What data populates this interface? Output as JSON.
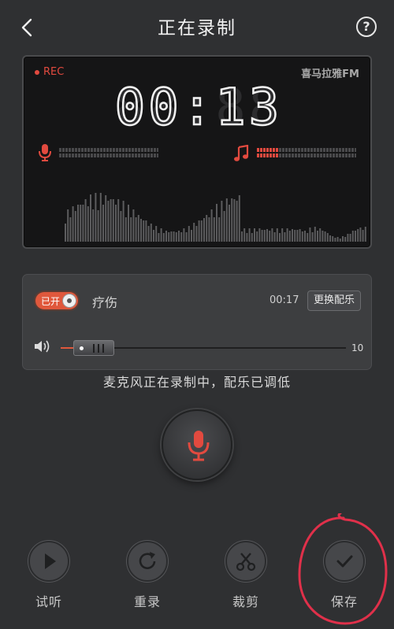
{
  "header": {
    "title": "正在录制",
    "back_icon": "chevron-left-icon",
    "help_label": "?"
  },
  "display": {
    "rec_label": "REC",
    "brand": "喜马拉雅FM",
    "timer": {
      "minutes": "00",
      "separator": ":",
      "seconds": "13"
    },
    "mic_level": 0.0,
    "music_level": 0.18,
    "accent_color": "#e24a3f"
  },
  "music": {
    "toggle_label": "已开",
    "toggle_on": true,
    "track_name": "疗伤",
    "duration": "00:17",
    "change_button": "更换配乐",
    "volume_value": "10",
    "volume_level": 0.1
  },
  "status": "麦克风正在录制中，配乐已调低",
  "record_button": {
    "icon": "microphone-icon",
    "color": "#e24a3f"
  },
  "actions": [
    {
      "label": "试听",
      "icon": "play-icon"
    },
    {
      "label": "重录",
      "icon": "refresh-icon"
    },
    {
      "label": "裁剪",
      "icon": "scissors-icon"
    },
    {
      "label": "保存",
      "icon": "check-icon"
    }
  ],
  "colors": {
    "background": "#2f3032",
    "accent": "#e0583c",
    "annotation": "#e0304a"
  }
}
